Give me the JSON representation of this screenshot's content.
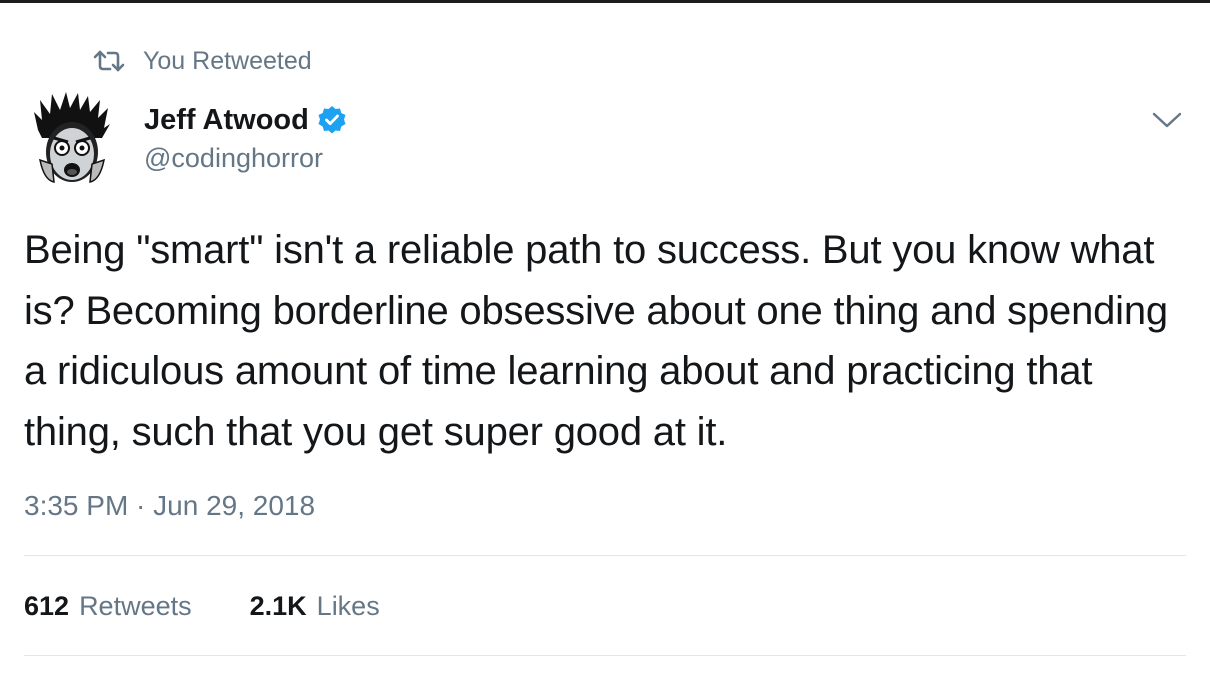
{
  "retweet_context": {
    "icon": "retweet-icon",
    "text": "You Retweeted"
  },
  "author": {
    "display_name": "Jeff Atwood",
    "handle": "@codinghorror",
    "verified": true,
    "verified_color": "#1da1f2"
  },
  "tweet": {
    "text": "Being \"smart\" isn't a reliable path to success. But you know what is? Becoming borderline obsessive about one thing and spending a ridiculous amount of time learning about and practicing that thing, such that you get super good at it.",
    "timestamp": "3:35 PM · Jun 29, 2018"
  },
  "stats": {
    "retweets_count": "612",
    "retweets_label": "Retweets",
    "likes_count": "2.1K",
    "likes_label": "Likes"
  },
  "colors": {
    "text_primary": "#14171a",
    "text_secondary": "#657786",
    "divider": "#e1e8ed",
    "accent": "#1da1f2"
  }
}
